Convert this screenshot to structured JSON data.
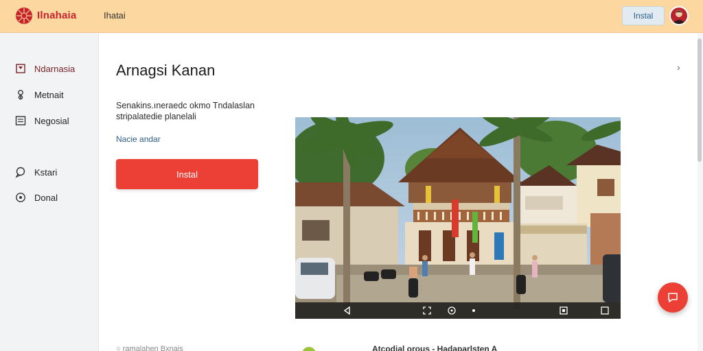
{
  "header": {
    "brand": "Ilnahaia",
    "tab": "Ihatai",
    "install_label": "Instal",
    "colors": {
      "background": "#fcd7a0",
      "brand": "#c8232b"
    }
  },
  "sidebar": {
    "items": [
      {
        "label": "Ndarnasia",
        "icon": "flag-icon",
        "active": true
      },
      {
        "label": "Metnait",
        "icon": "pin-icon"
      },
      {
        "label": "Negosial",
        "icon": "list-icon"
      },
      {
        "label": "Kstari",
        "icon": "chat-icon"
      },
      {
        "label": "Donal",
        "icon": "circle-info-icon"
      }
    ]
  },
  "main": {
    "title": "Arnagsi Kanan",
    "description_line1": "Senakins.ıneraedc okmo Tndalaslan",
    "description_line2": "stripalatedie planelali",
    "link": "Nacie andar",
    "install_label": "Instal",
    "accent_color": "#ec4036"
  },
  "photo": {
    "controls": [
      "back-icon",
      "fullscreen-icon",
      "settings-icon",
      "volume-icon",
      "caption-icon",
      "expand-icon"
    ]
  },
  "bottom": {
    "left_text": "○ ramalahen Bxnais",
    "right_text": "Atcodial orous - Hadaparlsten A"
  }
}
